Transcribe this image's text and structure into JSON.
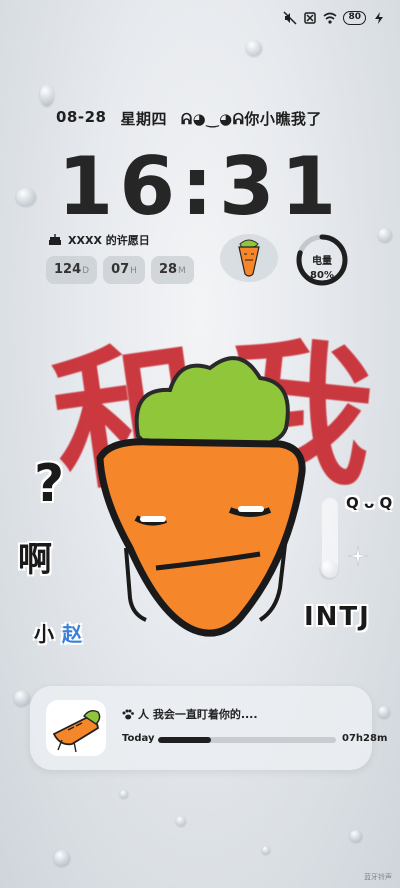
{
  "status_bar": {
    "battery_level": "80"
  },
  "date_row": {
    "date": "08-28",
    "weekday": "星期四",
    "tagline": "ᕱ◕‿◕ᕱ你小瞧我了"
  },
  "clock": {
    "time": "16:31"
  },
  "wish_widget": {
    "label": "XXXX 的许愿日",
    "days": "124",
    "days_unit": "D",
    "hours": "07",
    "hours_unit": "H",
    "minutes": "28",
    "minutes_unit": "M"
  },
  "battery_widget": {
    "label": "电量",
    "value": "80%",
    "level": 0.8
  },
  "graffiti": {
    "left": "和",
    "right": "我"
  },
  "stickers": {
    "question": "?",
    "exclaim": "啊",
    "name_a": "小",
    "name_b": "赵",
    "mbti": "INTJ",
    "face": "Q ᴗ Q"
  },
  "music_widget": {
    "title": "人 我会一直盯着你的....",
    "left_label": "Today",
    "right_label": "07h28m",
    "progress": 0.3
  },
  "watermark": "蓝牙铃声",
  "colors": {
    "carrot": "#f6862a",
    "leaf": "#8fc63a",
    "graffiti": "#c8262d"
  },
  "icons": [
    "mute-icon",
    "no-sim-icon",
    "wifi-icon",
    "charging-icon",
    "cake-icon",
    "paw-icon",
    "carrot-mascot-icon",
    "sparkle-icon"
  ]
}
